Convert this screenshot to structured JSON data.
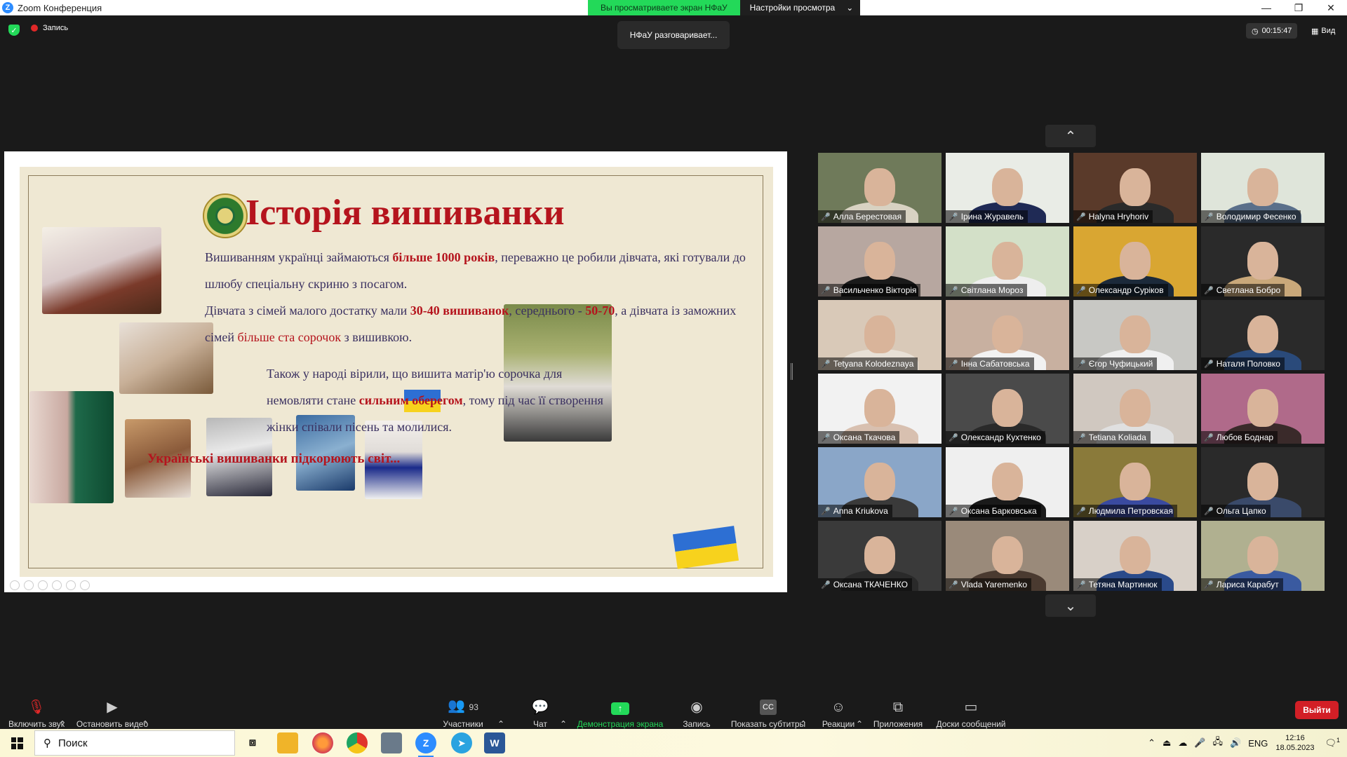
{
  "window": {
    "app_logo": "Z",
    "title": "Zoom Конференция",
    "share_banner": "Вы просматриваете экран НФаУ",
    "view_options": "Настройки просмотра",
    "minimize": "—",
    "maximize": "❐",
    "close": "✕"
  },
  "status": {
    "recording_label": "Запись",
    "speaking": "НФаУ разговаривает...",
    "timer": "00:15:47",
    "view_label": "Вид"
  },
  "slide": {
    "title": "Історія вишиванки",
    "p1_a": "Вишиванням українці займаються ",
    "p1_b": "більше 1000 років",
    "p1_c": ", переважно це робили дівчата, які готували до шлюбу спеціальну скриню з посагом.",
    "p2_a": "Дівчата з сімей малого достатку мали ",
    "p2_b": "30-40 вишиванок",
    "p2_c": ", середнього - ",
    "p2_d": "50-70",
    "p2_e": ", а дівчата із заможних сімей ",
    "p2_f": "більше ста сорочок",
    "p2_g": " з вишивкою.",
    "p3_a": "Також у народі вірили, що вишита матір'ю сорочка для немовляти стане ",
    "p3_b": "сильним оберегом",
    "p3_c": ", тому під час її створення жінки співали пісень та молилися.",
    "conquer": "Українські вишиванки підкорюють світ..."
  },
  "gallery": {
    "up_arrow": "⌃",
    "down_arrow": "⌄",
    "participants": [
      {
        "name": "Алла Берестовая",
        "bg": "#6f7a5a",
        "shirt": "#d8d2c2"
      },
      {
        "name": "Ірина Журавель",
        "bg": "#e9ece6",
        "shirt": "#1f2a55"
      },
      {
        "name": "Halyna Hryhoriv",
        "bg": "#5a3a2a",
        "shirt": "#2a2a2a"
      },
      {
        "name": "Володимир Фесенко",
        "bg": "#dfe5da",
        "shirt": "#5a6f8a"
      },
      {
        "name": "Васильченко Вікторія",
        "bg": "#b7a7a0",
        "shirt": "#1a1a1a"
      },
      {
        "name": "Світлана Мороз",
        "bg": "#d3e0c8",
        "shirt": "#eeeeee"
      },
      {
        "name": "Олександр Суріков",
        "bg": "#d9a632",
        "shirt": "#1c2a3a"
      },
      {
        "name": "Светлана Бобро",
        "bg": "#2a2a2a",
        "shirt": "#c9a87a"
      },
      {
        "name": "Tetyana Kolodeznaya",
        "bg": "#d9c9b8",
        "shirt": "#e8e0d6"
      },
      {
        "name": "Інна Сабатовська",
        "bg": "#c8b0a0",
        "shirt": "#f2f2f2"
      },
      {
        "name": "Єгор Чуфицький",
        "bg": "#c8c8c4",
        "shirt": "#f0f0f0"
      },
      {
        "name": "Наталя Половко",
        "bg": "#2a2a2a",
        "shirt": "#2a4a7a"
      },
      {
        "name": "Оксана Ткачова",
        "bg": "#f2f2f2",
        "shirt": "#d8c0b0"
      },
      {
        "name": "Олександр Кухтенко",
        "bg": "#4a4a4a",
        "shirt": "#2a2a2a"
      },
      {
        "name": "Tetiana Koliada",
        "bg": "#d0c8c0",
        "shirt": "#e0e0e0"
      },
      {
        "name": "Любов Боднар",
        "bg": "#b06a8a",
        "shirt": "#3a2a2a"
      },
      {
        "name": "Anna Kriukova",
        "bg": "#8aa6c8",
        "shirt": "#3a3a3a"
      },
      {
        "name": "Оксана Барковська",
        "bg": "#efefef",
        "shirt": "#1a1a1a"
      },
      {
        "name": "Людмила Петровская",
        "bg": "#8a7a3a",
        "shirt": "#3a4aa0"
      },
      {
        "name": "Ольга Цапко",
        "bg": "#2a2a2a",
        "shirt": "#3a4a6a"
      },
      {
        "name": "Оксана ТКАЧЕНКО",
        "bg": "#3a3a3a",
        "shirt": "#2a2a2a"
      },
      {
        "name": "Vlada Yaremenko",
        "bg": "#9a8a7a",
        "shirt": "#4a3a30"
      },
      {
        "name": "Тетяна Мартинюк",
        "bg": "#d8d0c8",
        "shirt": "#2a4a8a"
      },
      {
        "name": "Лариса Карабут",
        "bg": "#b0b090",
        "shirt": "#3a5aa0"
      }
    ]
  },
  "toolbar": {
    "unmute": "Включить звук",
    "stop_video": "Остановить видео",
    "participants_count": "93",
    "participants": "Участники",
    "chat": "Чат",
    "share": "Демонстрация экрана",
    "record": "Запись",
    "captions_icon": "CC",
    "captions": "Показать субтитры",
    "reactions": "Реакции",
    "apps": "Приложения",
    "whiteboards": "Доски сообщений",
    "exit": "Выйти"
  },
  "taskbar": {
    "search": "Поиск",
    "zoom_icon": "Z",
    "word_icon": "W",
    "lang": "ENG",
    "time": "12:16",
    "date": "18.05.2023",
    "notification_count": "1"
  }
}
